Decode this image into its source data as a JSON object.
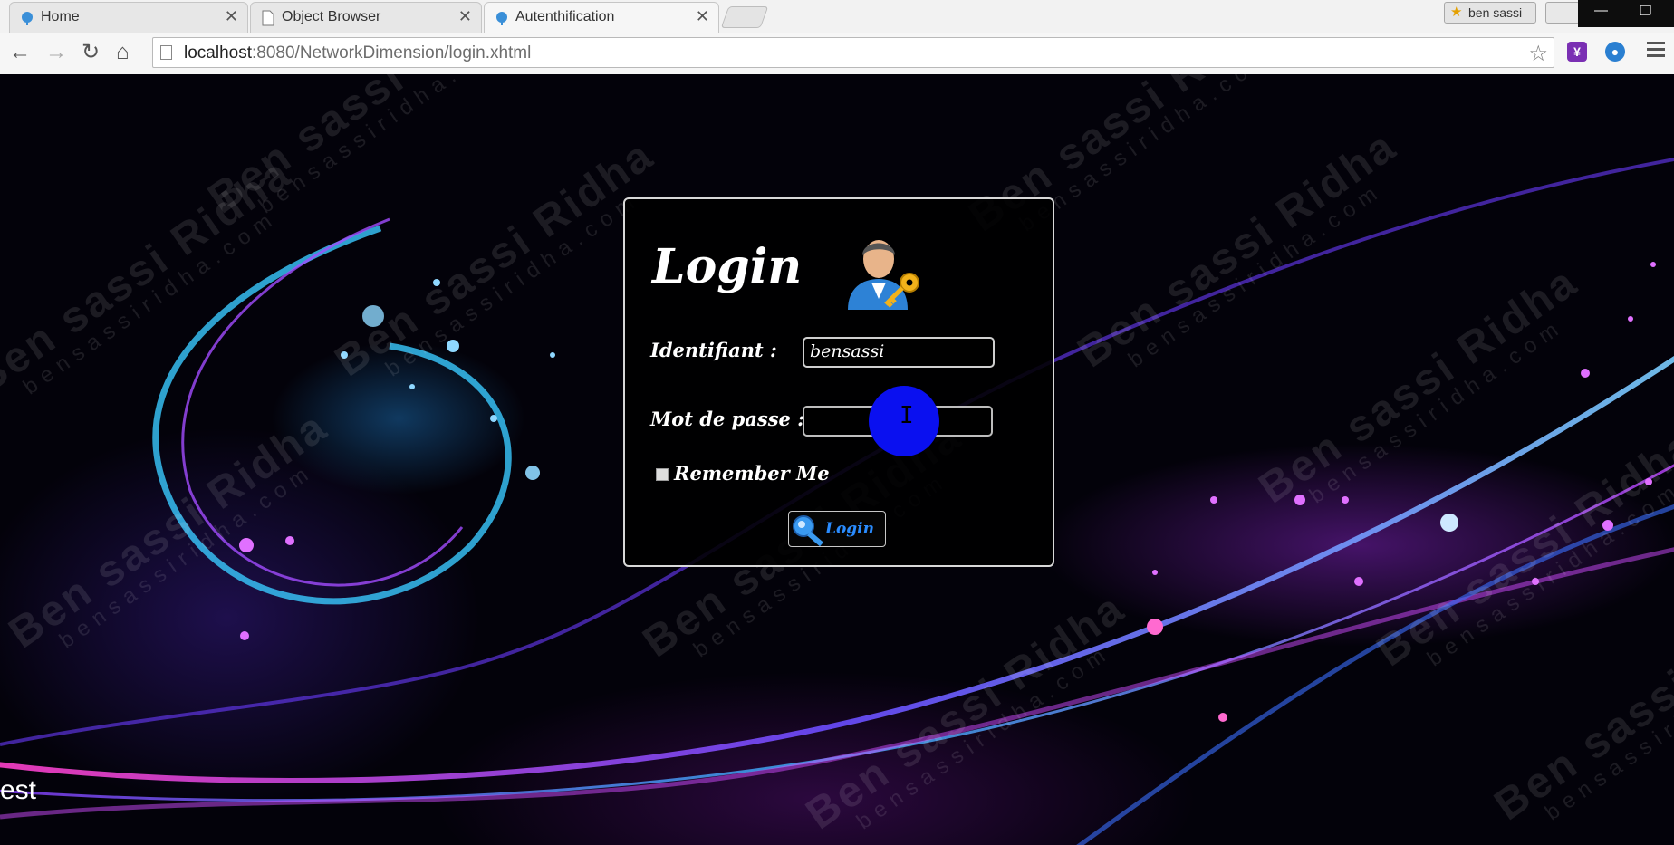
{
  "browser": {
    "tabs": [
      {
        "title": "Home"
      },
      {
        "title": "Object Browser"
      },
      {
        "title": "Autenthification"
      }
    ],
    "user_badge": "ben sassi",
    "url_host": "localhost",
    "url_rest": ":8080/NetworkDimension/login.xhtml"
  },
  "login": {
    "title": "Login",
    "identifiant_label": "Identifiant :",
    "identifiant_value": "bensassi",
    "password_label": "Mot de passe :",
    "password_value": "",
    "remember_label": "Remember Me",
    "button_label": "Login"
  },
  "page": {
    "bottom_text": "est"
  },
  "watermark": {
    "line1": "Ben sassi Ridha",
    "line2": "bensassiridha.com"
  },
  "colors": {
    "accent_button_text": "#2a8cff",
    "cursor_highlight": "#0a10f0"
  }
}
